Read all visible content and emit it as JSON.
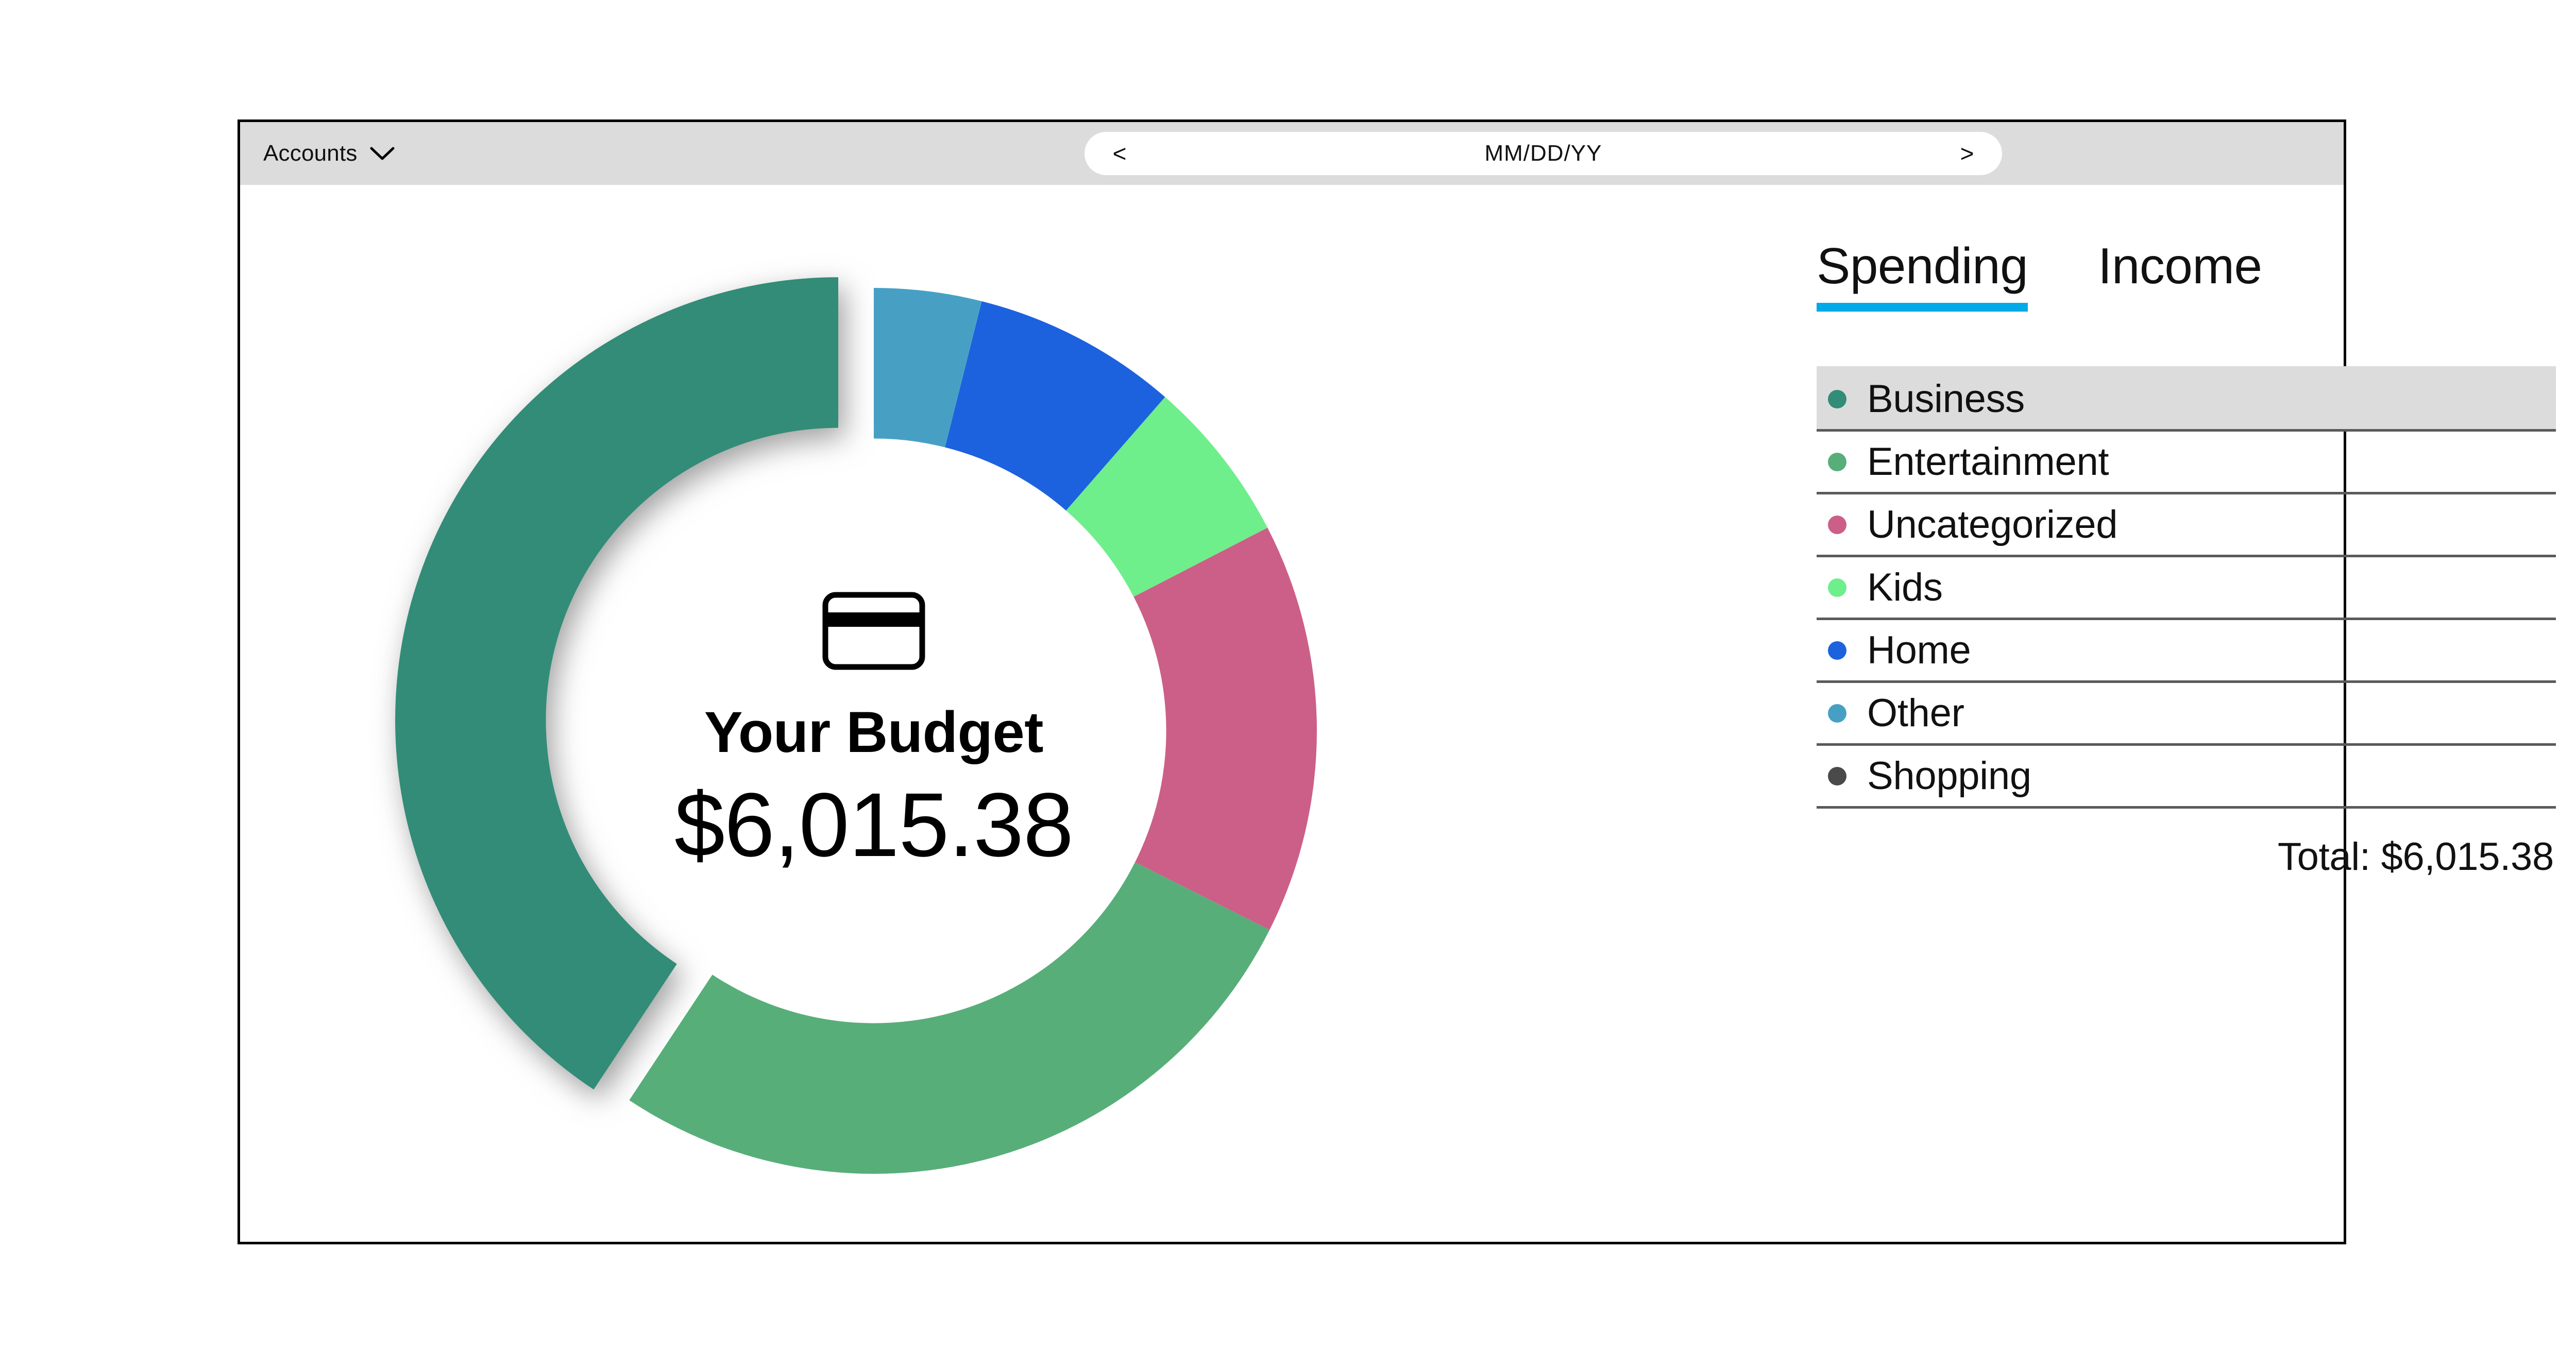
{
  "window": {
    "toolbar": {
      "accounts_label": "Accounts",
      "accounts_chevron_icon": "chevron-down-icon",
      "date_prev_label": "<",
      "date_value": "MM/DD/YY",
      "date_next_label": ">"
    }
  },
  "center": {
    "card_icon": "credit-card-icon",
    "title": "Your Budget",
    "amount": "$6,015.38"
  },
  "tabs": [
    {
      "label": "Spending",
      "active": true
    },
    {
      "label": "Income",
      "active": false
    }
  ],
  "categories": [
    {
      "label": "Business",
      "color": "#318C78",
      "selected": true
    },
    {
      "label": "Entertainment",
      "color": "#57AE79",
      "selected": false
    },
    {
      "label": "Uncategorized",
      "color": "#CC5F87",
      "selected": false
    },
    {
      "label": "Kids",
      "color": "#6FEE8C",
      "selected": false
    },
    {
      "label": "Home",
      "color": "#1C62DE",
      "selected": false
    },
    {
      "label": "Other",
      "color": "#47A0C4",
      "selected": false
    },
    {
      "label": "Shopping",
      "color": "#4A4A4A",
      "selected": false
    }
  ],
  "total": {
    "label": "Total: $6,015.38"
  },
  "theme": {
    "accent": "#00A9E8",
    "toolbar_bg": "#DCDCDC",
    "selected_row_bg": "#DCDCDC",
    "divider": "#5A5A5A",
    "window_border": "#000000"
  },
  "chart_data": {
    "type": "pie",
    "title": "Your Budget",
    "center_value": "$6,015.38",
    "total": 6015.38,
    "total_label": "Total: $6,015.38",
    "legend_position": "right",
    "donut": true,
    "inner_radius_ratio": 0.66,
    "start_angle_deg": 0,
    "direction": "counterclockwise",
    "exploded_slice": "Business",
    "categories": [
      "Business",
      "Entertainment",
      "Uncategorized",
      "Kids",
      "Home",
      "Other"
    ],
    "colors": [
      "#318C78",
      "#57AE79",
      "#CC5F87",
      "#6FEE8C",
      "#1C62DE",
      "#47A0C4"
    ],
    "values": [
      2446.25,
      1617.13,
      902.31,
      360.92,
      451.15,
      237.62
    ],
    "percents": [
      40.7,
      26.9,
      15.0,
      6.0,
      7.5,
      3.9
    ],
    "slices": [
      {
        "name": "Business",
        "color": "#318C78",
        "percent": 40.7,
        "value": 2446.25,
        "start_deg": 0,
        "end_deg": 146.5,
        "exploded": true
      },
      {
        "name": "Entertainment",
        "color": "#57AE79",
        "percent": 26.9,
        "value": 1617.13,
        "start_deg": 146.5,
        "end_deg": 243.3,
        "exploded": false
      },
      {
        "name": "Uncategorized",
        "color": "#CC5F87",
        "percent": 15.0,
        "value": 902.31,
        "start_deg": 243.3,
        "end_deg": 297.3,
        "exploded": false
      },
      {
        "name": "Kids",
        "color": "#6FEE8C",
        "percent": 6.0,
        "value": 360.92,
        "start_deg": 297.3,
        "end_deg": 318.9,
        "exploded": false
      },
      {
        "name": "Home",
        "color": "#1C62DE",
        "percent": 7.5,
        "value": 451.15,
        "start_deg": 318.9,
        "end_deg": 345.9,
        "exploded": false
      },
      {
        "name": "Other",
        "color": "#47A0C4",
        "percent": 3.9,
        "value": 237.62,
        "start_deg": 345.9,
        "end_deg": 360.0,
        "exploded": false
      }
    ]
  }
}
